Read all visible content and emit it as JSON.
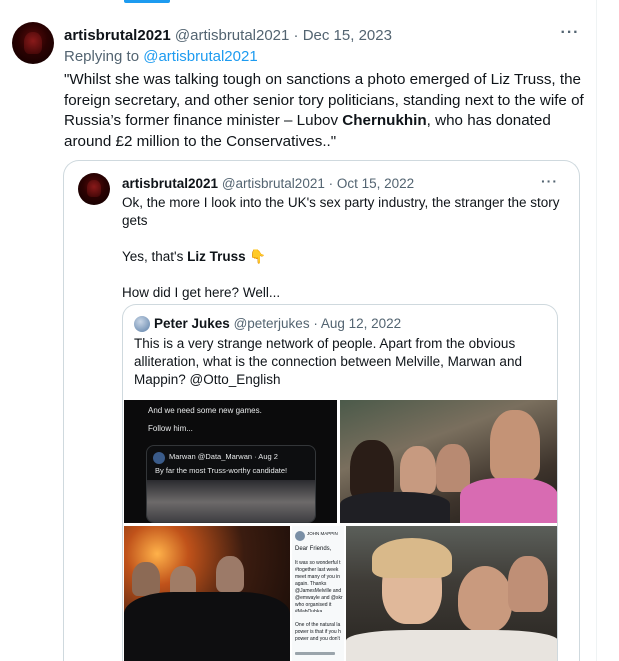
{
  "tweet": {
    "display_name": "artisbrutal2021",
    "handle": "@artisbrutal2021",
    "separator": "·",
    "date": "Dec 15, 2023",
    "more_label": "···",
    "replying_to_prefix": "Replying to ",
    "replying_to_handle": "@artisbrutal2021",
    "text_part1": "\"Whilst she was talking tough on sanctions a photo emerged of Liz Truss, the foreign secretary, and other senior tory politicians, standing next  to the wife of Russia’s former finance minister – Lubov ",
    "text_bold": "Chernukhin",
    "text_part2": ", who has donated around £2 million to the Conservatives..\""
  },
  "quote1": {
    "display_name": "artisbrutal2021",
    "handle": "@artisbrutal2021",
    "separator": "·",
    "date": "Oct 15, 2022",
    "more_label": "···",
    "line1": "Ok, the more I look into the UK's sex party industry, the stranger the story gets",
    "line2_prefix": "Yes, that's ",
    "line2_bold": "Liz Truss",
    "line2_emoji": "👇",
    "line3": "How did I get here?  Well..."
  },
  "quote2": {
    "display_name": "Peter Jukes",
    "handle": "@peterjukes",
    "separator": "·",
    "date": "Aug 12, 2022",
    "text": "This is a very strange network of people. Apart from the obvious alliteration, what is the connection between Melville, Marwan and Mappin? @Otto_English",
    "image_tl": {
      "line1": "And we need some new games.",
      "line2": "Follow him...",
      "card_author": "Marwan @Data_Marwan · Aug 2",
      "card_text": "By far the most Truss-worthy candidate!"
    },
    "image_bm": {
      "author": "JOHN MAPPIN",
      "greeting": "Dear Friends,",
      "body": "It was so wonderful t #together last week meet many of you in again. Thanks @JamesMelville and @emwayle and @skr who organised it #MahOubka",
      "footer": "One of the natural la power is that if you h power and you don't"
    }
  }
}
